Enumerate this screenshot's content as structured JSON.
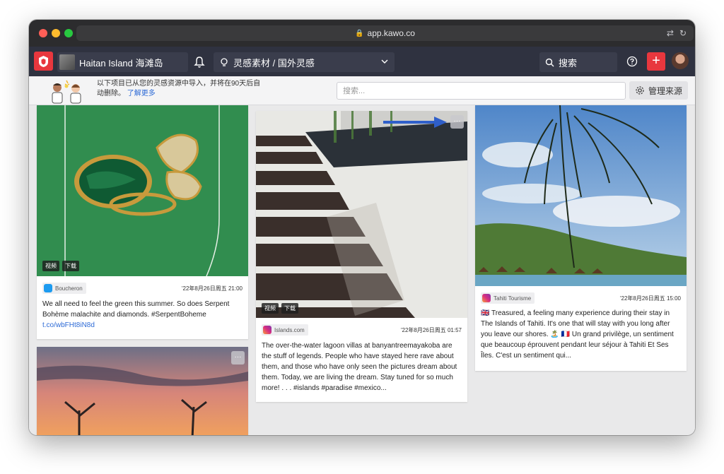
{
  "browser": {
    "url": "app.kawo.co"
  },
  "appbar": {
    "workspace_name": "Haitan Island 海滩岛",
    "breadcrumb": "灵感素材 / 国外灵感",
    "search_label": "搜索",
    "plus_label": "+"
  },
  "subbar": {
    "notice_text": "以下项目已从您的灵感资源中导入，并将在90天后自动删除。",
    "learn_more": "了解更多",
    "search_placeholder": "搜索...",
    "manage_sources": "管理来源"
  },
  "cards": [
    {
      "tags": [
        "视频",
        "下载"
      ],
      "source": "Boucheron",
      "source_icon": "twitter-icon",
      "date": "'22年8月26日周五 21:00",
      "text": "We all need to feel the green this summer. So does Serpent Bohème malachite and diamonds. #SerpentBoheme",
      "link": "t.co/wbFHt8iN8d"
    },
    {
      "tags": [
        "视频",
        "下载"
      ],
      "source": "Islands.com",
      "source_icon": "instagram-icon",
      "date": "'22年8月26日周五 01:57",
      "text": "The over-the-water lagoon villas at banyantreemayakoba are the stuff of legends. People who have stayed here rave about them, and those who have only seen the pictures dream about them. Today, we are living the dream. Stay tuned for so much more! . . . #islands #paradise #mexico..."
    },
    {
      "tags": [],
      "source": "Tahiti Tourisme",
      "source_icon": "instagram-icon",
      "date": "'22年8月26日周五 15:00",
      "text": "🇬🇧 Treasured, a feeling many experience during their stay in The Islands of Tahiti. It's one that will stay with you long after you leave our shores. 🏝️ 🇫🇷 Un grand privilège, un sentiment que beaucoup éprouvent pendant leur séjour à Tahiti Et Ses Îles. C'est un sentiment qui..."
    }
  ],
  "more_label": "···",
  "colors": {
    "accent": "#e8373e",
    "appbar": "#2f3240",
    "link": "#2e6bd6",
    "arrow": "#2f5fc9"
  }
}
